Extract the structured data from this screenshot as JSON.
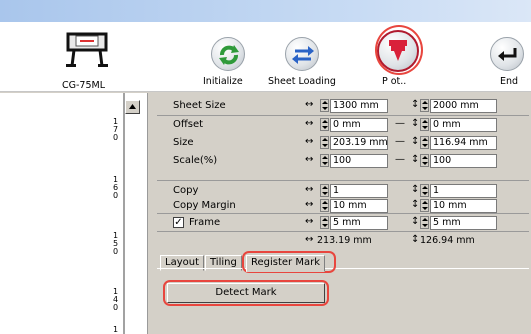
{
  "toolbar": {
    "device_label": "CG-75ML",
    "buttons": [
      {
        "label": "Initialize",
        "icon": "refresh-icon"
      },
      {
        "label": "Sheet Loading",
        "icon": "swap-arrows-icon"
      },
      {
        "label": "P ot..",
        "icon": "plot-icon"
      },
      {
        "label": "End",
        "icon": "return-icon"
      }
    ]
  },
  "ruler": {
    "labels": [
      "1\n7\n0",
      "1\n6\n0",
      "1\n5\n0",
      "1\n4\n0",
      "1"
    ]
  },
  "properties": {
    "rows": [
      {
        "label": "Sheet Size",
        "w": "1300 mm",
        "h": "2000 mm"
      },
      {
        "label": "Offset",
        "w": "0 mm",
        "h": "0 mm"
      },
      {
        "label": "Size",
        "w": "203.19 mm",
        "h": "116.94 mm"
      },
      {
        "label": "Scale(%)",
        "w": "100",
        "h": "100"
      },
      {
        "label": "Copy",
        "w": "1",
        "h": "1"
      },
      {
        "label": "Copy Margin",
        "w": "10 mm",
        "h": "10 mm"
      },
      {
        "label": "Frame",
        "w": "5 mm",
        "h": "5 mm",
        "checked": true
      }
    ],
    "total_w": "213.19 mm",
    "total_h": "126.94 mm",
    "glyph_w": "↔",
    "glyph_h": "↕",
    "glyph_link": "—",
    "check_mark": "✓"
  },
  "tabs": [
    "Layout",
    "Tiling",
    "Register Mark"
  ],
  "active_tab": "Register Mark",
  "detect_button": "Detect Mark",
  "colors": {
    "highlight": "#e8463e",
    "plot_button": "#d9213a",
    "initialize_icon": "#2f9a3a",
    "sheet_loading_icon": "#2a63c6"
  }
}
